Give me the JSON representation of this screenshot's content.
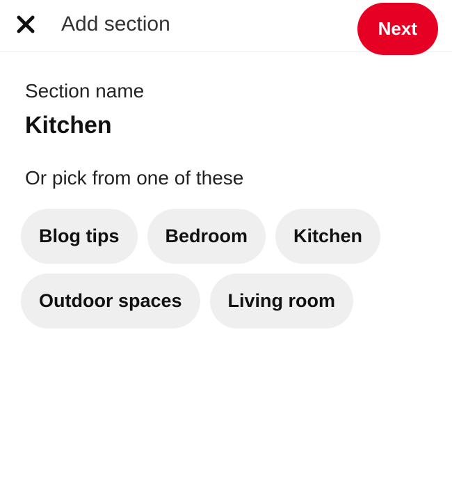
{
  "header": {
    "title": "Add section",
    "next_label": "Next"
  },
  "form": {
    "section_name_label": "Section name",
    "section_name_value": "Kitchen",
    "pick_label": "Or pick from one of these"
  },
  "suggestions": [
    "Blog tips",
    "Bedroom",
    "Kitchen",
    "Outdoor spaces",
    "Living room"
  ]
}
